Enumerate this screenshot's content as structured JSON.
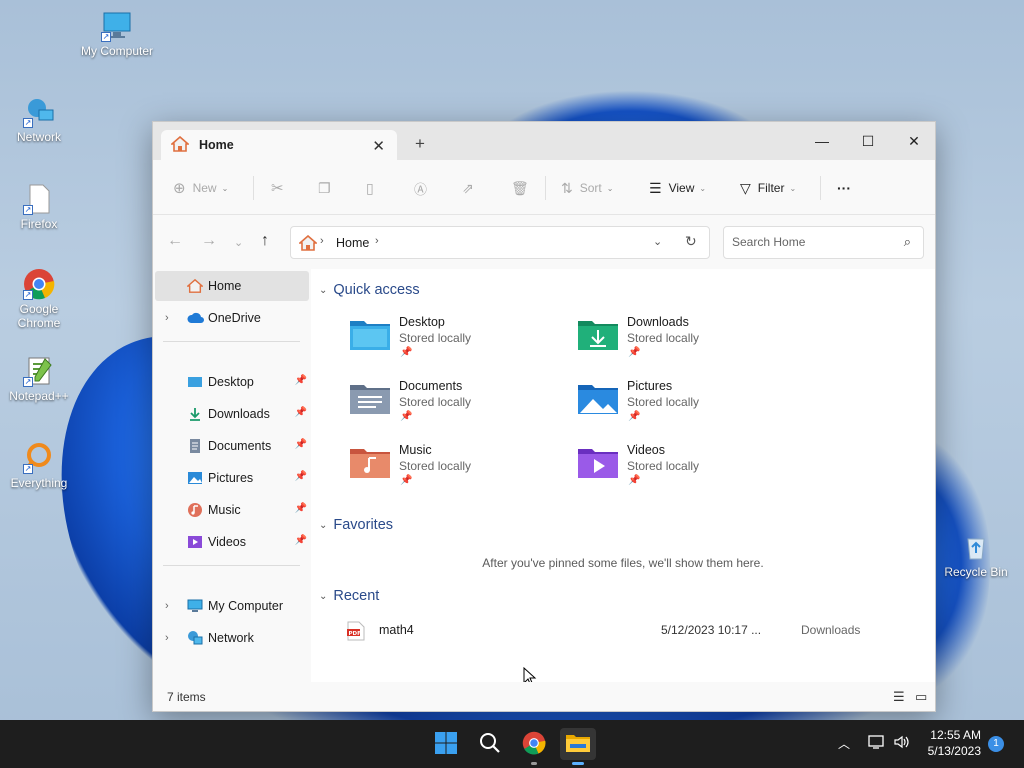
{
  "desktop": {
    "icons": [
      {
        "label": "My Computer"
      },
      {
        "label": "Network"
      },
      {
        "label": "Firefox"
      },
      {
        "label": "Google Chrome"
      },
      {
        "label": "Notepad++"
      },
      {
        "label": "Everything"
      },
      {
        "label": "Recycle Bin"
      }
    ]
  },
  "window": {
    "tab_title": "Home",
    "toolbar": {
      "new_label": "New",
      "sort_label": "Sort",
      "view_label": "View",
      "filter_label": "Filter",
      "more_label": "···"
    },
    "address": {
      "crumb": "Home",
      "search_placeholder": "Search Home"
    },
    "sidebar": {
      "top": [
        {
          "label": "Home",
          "icon": "home-icon"
        },
        {
          "label": "OneDrive",
          "icon": "cloud-icon"
        }
      ],
      "pinned": [
        {
          "label": "Desktop",
          "icon": "desktop-folder-icon"
        },
        {
          "label": "Downloads",
          "icon": "download-icon"
        },
        {
          "label": "Documents",
          "icon": "document-icon"
        },
        {
          "label": "Pictures",
          "icon": "pictures-icon"
        },
        {
          "label": "Music",
          "icon": "music-icon"
        },
        {
          "label": "Videos",
          "icon": "videos-icon"
        }
      ],
      "bottom": [
        {
          "label": "My Computer",
          "icon": "computer-icon"
        },
        {
          "label": "Network",
          "icon": "network-icon"
        }
      ]
    },
    "main": {
      "quick_access_title": "Quick access",
      "quick_access": [
        {
          "name": "Desktop",
          "sub": "Stored locally"
        },
        {
          "name": "Downloads",
          "sub": "Stored locally"
        },
        {
          "name": "Documents",
          "sub": "Stored locally"
        },
        {
          "name": "Pictures",
          "sub": "Stored locally"
        },
        {
          "name": "Music",
          "sub": "Stored locally"
        },
        {
          "name": "Videos",
          "sub": "Stored locally"
        }
      ],
      "favorites_title": "Favorites",
      "favorites_empty": "After you've pinned some files, we'll show them here.",
      "recent_title": "Recent",
      "recent": [
        {
          "name": "math4",
          "date": "5/12/2023 10:17 ...",
          "location": "Downloads"
        }
      ]
    },
    "status": {
      "items": "7 items"
    }
  },
  "taskbar": {
    "time": "12:55 AM",
    "date": "5/13/2023",
    "notification_count": "1"
  },
  "colors": {
    "accent": "#0067c0",
    "section_title": "#2a4a8a",
    "taskbar_bg": "#1e1e1e"
  }
}
